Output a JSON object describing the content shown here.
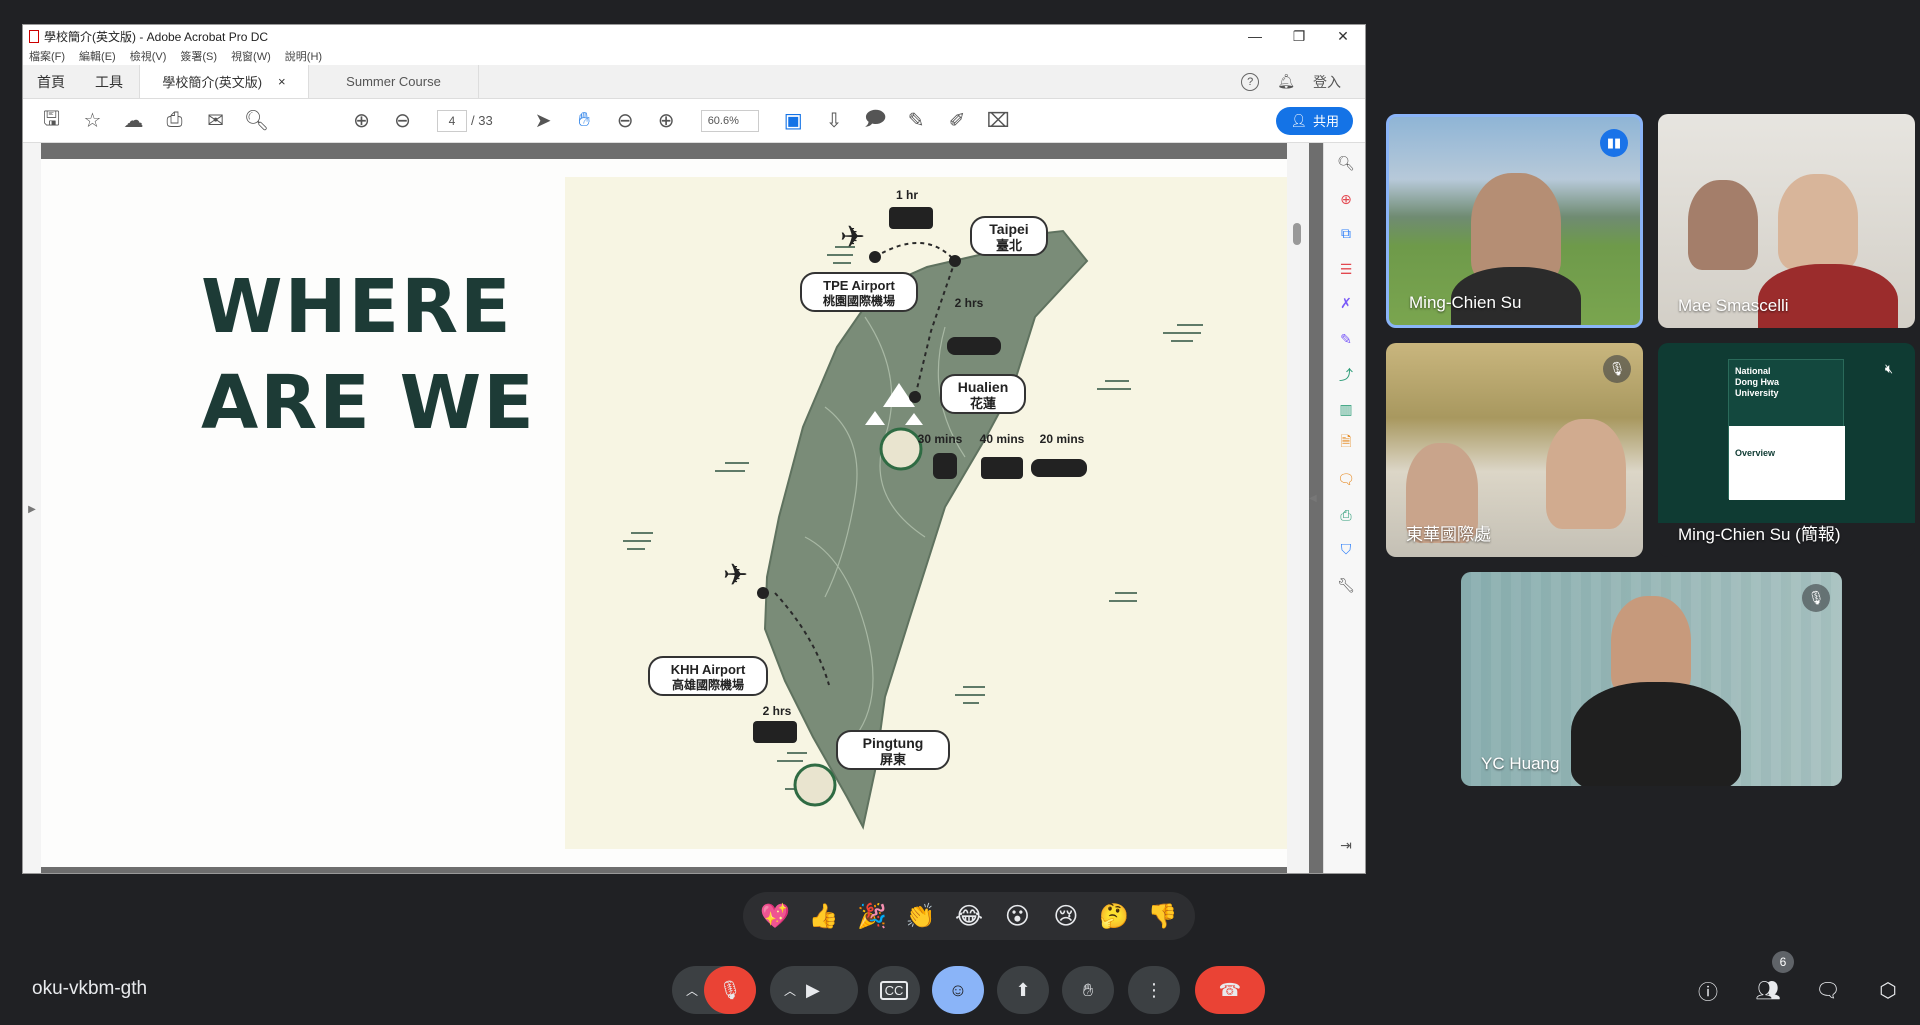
{
  "acrobat": {
    "title": "學校簡介(英文版) - Adobe Acrobat Pro DC",
    "menu": [
      "檔案(F)",
      "編輯(E)",
      "檢視(V)",
      "簽署(S)",
      "視窗(W)",
      "說明(H)"
    ],
    "tabs": {
      "home": "首頁",
      "tools": "工具",
      "doc1": "學校簡介(英文版)",
      "doc2": "Summer Course",
      "login": "登入"
    },
    "page_current": "4",
    "page_total": "/ 33",
    "zoom": "60.6%",
    "share": "共用"
  },
  "slide": {
    "headline_line1": "WHERE",
    "headline_line2": "ARE WE ?",
    "labels": {
      "taipei_en": "Taipei",
      "taipei_zh": "臺北",
      "tpe_en": "TPE Airport",
      "tpe_zh": "桃園國際機場",
      "hualien_en": "Hualien",
      "hualien_zh": "花蓮",
      "khh_en": "KHH Airport",
      "khh_zh": "高雄國際機場",
      "pingtung_en": "Pingtung",
      "pingtung_zh": "屏東",
      "t_1hr": "1 hr",
      "t_2hrs_n": "2 hrs",
      "t_2hrs_s": "2 hrs",
      "t_30": "30 mins",
      "t_40": "40 mins",
      "t_20": "20 mins"
    }
  },
  "participants": [
    {
      "name": "Ming-Chien Su"
    },
    {
      "name": "Mae Smascelli"
    },
    {
      "name": "東華國際處"
    },
    {
      "name": "Ming-Chien Su (簡報)"
    },
    {
      "name": "YC Huang"
    }
  ],
  "presentation_thumb": {
    "line1": "National",
    "line2": "Dong Hwa",
    "line3": "University",
    "overview": "Overview"
  },
  "reactions": [
    "💖",
    "👍",
    "🎉",
    "👏",
    "😂",
    "😮",
    "😢",
    "🤔",
    "👎"
  ],
  "meeting_code": "oku-vkbm-gth",
  "people_count": "6"
}
